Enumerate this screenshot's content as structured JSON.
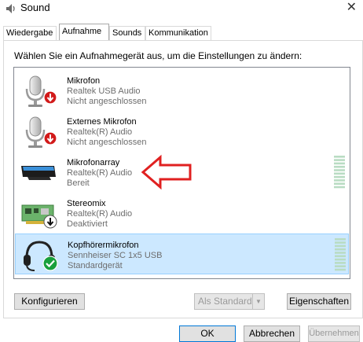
{
  "window": {
    "title": "Sound",
    "close_glyph": "✕"
  },
  "tabs": [
    {
      "label": "Wiedergabe",
      "active": false
    },
    {
      "label": "Aufnahme",
      "active": true
    },
    {
      "label": "Sounds",
      "active": false
    },
    {
      "label": "Kommunikation",
      "active": false
    }
  ],
  "instruction": "Wählen Sie ein Aufnahmegerät aus, um die Einstellungen zu ändern:",
  "devices": [
    {
      "name": "Mikrofon",
      "driver": "Realtek USB Audio",
      "status": "Nicht angeschlossen",
      "icon": "microphone-icon",
      "badge": "red-down-arrow-icon"
    },
    {
      "name": "Externes Mikrofon",
      "driver": "Realtek(R) Audio",
      "status": "Nicht angeschlossen",
      "icon": "microphone-icon",
      "badge": "red-down-arrow-icon"
    },
    {
      "name": "Mikrofonarray",
      "driver": "Realtek(R) Audio",
      "status": "Bereit",
      "icon": "microphone-array-icon",
      "badge": "none",
      "level": 0
    },
    {
      "name": "Stereomix",
      "driver": "Realtek(R) Audio",
      "status": "Deaktiviert",
      "icon": "sound-card-icon",
      "badge": "black-down-arrow-icon"
    },
    {
      "name": "Kopfhörermikrofon",
      "driver": "Sennheiser SC 1x5 USB",
      "status": "Standardgerät",
      "icon": "headset-icon",
      "badge": "green-check-icon",
      "selected": true,
      "level": 0
    }
  ],
  "buttons": {
    "configure": "Konfigurieren",
    "set_default": "Als Standard",
    "properties": "Eigenschaften",
    "ok": "OK",
    "cancel": "Abbrechen",
    "apply": "Übernehmen"
  },
  "colors": {
    "selection": "#cce8ff",
    "accent": "#0078d7",
    "annotation_arrow": "#e02020"
  }
}
